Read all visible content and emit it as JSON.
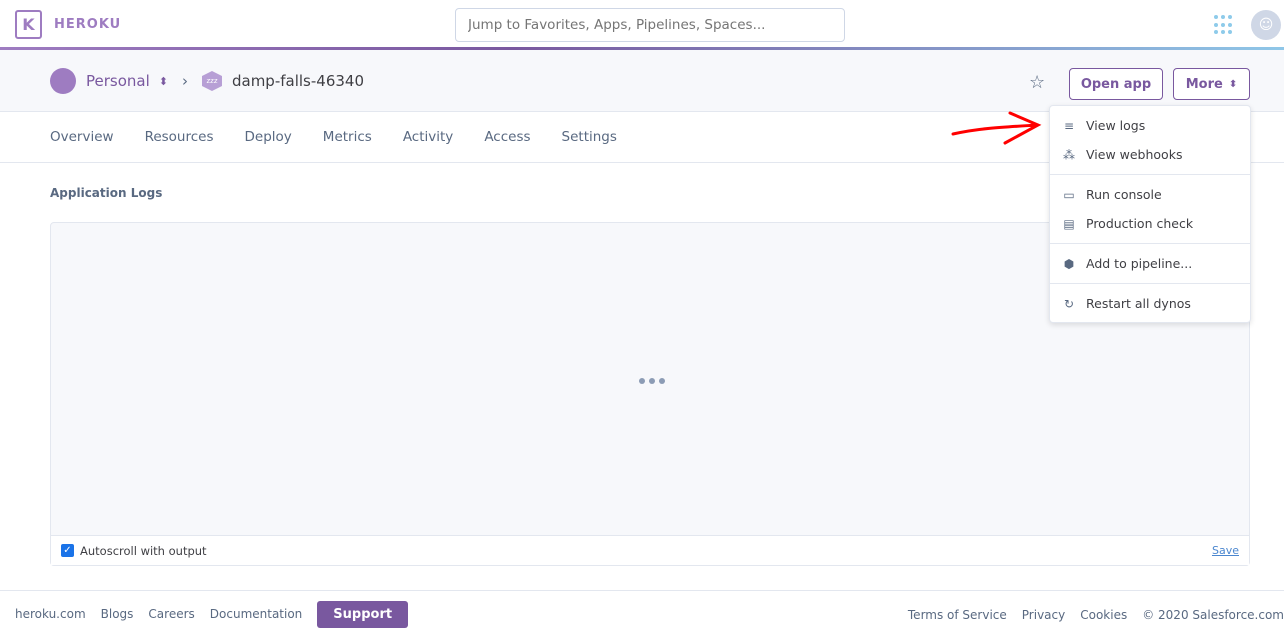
{
  "brand": {
    "name": "HEROKU",
    "logo_letter": "K"
  },
  "search": {
    "placeholder": "Jump to Favorites, Apps, Pipelines, Spaces..."
  },
  "breadcrumb": {
    "account": "Personal",
    "app": "damp-falls-46340",
    "app_badge": "zzz"
  },
  "actions": {
    "open_app": "Open app",
    "more": "More"
  },
  "tabs": [
    "Overview",
    "Resources",
    "Deploy",
    "Metrics",
    "Activity",
    "Access",
    "Settings"
  ],
  "logs": {
    "title": "Application Logs",
    "autoscroll_label": "Autoscroll with output",
    "autoscroll_checked": true,
    "save": "Save"
  },
  "more_menu": [
    {
      "label": "View logs",
      "icon": "lines-icon"
    },
    {
      "label": "View webhooks",
      "icon": "webhook-icon"
    },
    {
      "label": "Run console",
      "icon": "terminal-icon"
    },
    {
      "label": "Production check",
      "icon": "clipboard-icon"
    },
    {
      "label": "Add to pipeline...",
      "icon": "pipeline-icon"
    },
    {
      "label": "Restart all dynos",
      "icon": "restart-icon"
    }
  ],
  "footer": {
    "links": [
      "heroku.com",
      "Blogs",
      "Careers",
      "Documentation"
    ],
    "support": "Support",
    "right": [
      "Terms of Service",
      "Privacy",
      "Cookies",
      "© 2020 Salesforce.com"
    ]
  },
  "colors": {
    "brand": "#79589f",
    "annotation": "#ff0000"
  }
}
